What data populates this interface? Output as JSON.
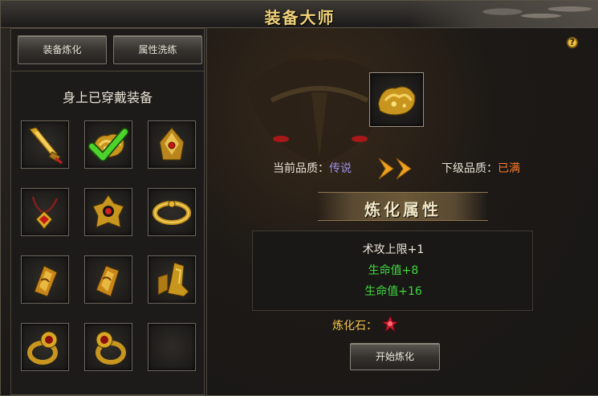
{
  "window": {
    "title": "装备大师"
  },
  "tabs": {
    "refine_label": "装备炼化",
    "wash_label": "属性洗练"
  },
  "equipment": {
    "heading": "身上已穿戴装备",
    "slots": [
      {
        "icon": "sword-icon"
      },
      {
        "icon": "dragon-armor-icon",
        "selected": true
      },
      {
        "icon": "helmet-icon"
      },
      {
        "icon": "necklace-icon"
      },
      {
        "icon": "medal-icon"
      },
      {
        "icon": "belt-icon"
      },
      {
        "icon": "bracer-left-icon"
      },
      {
        "icon": "bracer-right-icon"
      },
      {
        "icon": "boots-icon"
      },
      {
        "icon": "ring-left-icon"
      },
      {
        "icon": "ring-right-icon"
      },
      {
        "icon": "empty-slot"
      }
    ]
  },
  "refine": {
    "current_label": "当前品质：",
    "current_value": "传说",
    "next_label": "下级品质：",
    "next_value": "已满",
    "attr_title": "炼化属性",
    "attributes": [
      "术攻上限+1",
      "生命值+8",
      "生命值+16"
    ],
    "stone_label": "炼化石：",
    "start_label": "开始炼化"
  },
  "help": {
    "symbol": "?"
  },
  "colors": {
    "gold": "#f1d27a",
    "legend_quality": "#9b8fe4",
    "full_quality": "#ff7a2a",
    "attribute_green": "#3fd93f"
  }
}
